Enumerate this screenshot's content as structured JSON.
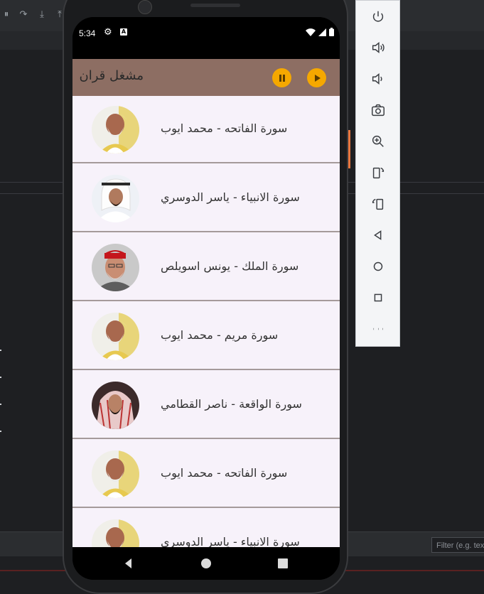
{
  "status_bar": {
    "time": "5:34"
  },
  "app": {
    "title": "مشغل قران",
    "accent_color": "#f5a800",
    "app_bar_color": "#8d6e63",
    "pause_icon": "pause-icon",
    "play_icon": "play-icon"
  },
  "tracks": [
    {
      "label": "سورة الفاتحه - محمد ايوب",
      "reciter_avatar": "reciter-1"
    },
    {
      "label": "سورة الانبياء - ياسر الدوسري",
      "reciter_avatar": "reciter-2"
    },
    {
      "label": "سورة الملك - يونس اسويلص",
      "reciter_avatar": "reciter-3"
    },
    {
      "label": "سورة مريم - محمد ايوب",
      "reciter_avatar": "reciter-1"
    },
    {
      "label": "سورة الواقعة - ناصر القطامي",
      "reciter_avatar": "reciter-4"
    },
    {
      "label": "سورة الفاتحه - محمد ايوب",
      "reciter_avatar": "reciter-1"
    },
    {
      "label": "سورة الانبياء - ياسر الدوسري",
      "reciter_avatar": "reciter-1"
    }
  ],
  "ide": {
    "filter_placeholder": "Filter (e.g. tex"
  },
  "emulator_toolbar": [
    "power-icon",
    "volume-up-icon",
    "volume-down-icon",
    "camera-icon",
    "zoom-icon",
    "rotate-left-icon",
    "rotate-right-icon",
    "back-icon",
    "home-icon",
    "overview-icon",
    "more-icon"
  ]
}
